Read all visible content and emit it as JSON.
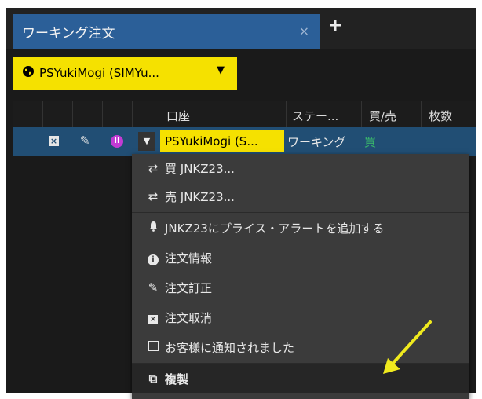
{
  "tab": {
    "title": "ワーキング注文",
    "close_icon": "×",
    "add_icon": "+"
  },
  "account_selector": {
    "label": "PSYukiMogi (SIMYu...",
    "globe_icon": "globe-icon",
    "caret": "▼"
  },
  "table": {
    "headers": [
      "口座",
      "ステー...",
      "買/売",
      "枚数"
    ],
    "row": {
      "cancel_icon": "×",
      "edit_icon": "✎",
      "pause_icon": "II",
      "dropdown": "▼",
      "account": "PSYukiMogi (S...",
      "status": "ワーキング",
      "side": "買"
    }
  },
  "context_menu": {
    "items": [
      {
        "icon": "⇄",
        "label": "買 JNKZ23..."
      },
      {
        "icon": "⇄",
        "label": "売 JNKZ23..."
      },
      {
        "icon": "🔔",
        "label": "JNKZ23にプライス・アラートを追加する"
      },
      {
        "icon": "i",
        "label": "注文情報"
      },
      {
        "icon": "✎",
        "label": "注文訂正"
      },
      {
        "icon": "×",
        "label": "注文取消"
      },
      {
        "icon": "□",
        "label": "お客様に通知されました"
      },
      {
        "icon": "⧉",
        "label": "複製"
      }
    ]
  },
  "colors": {
    "tab_active": "#2b5f98",
    "highlight_yellow": "#f5e100",
    "row_selected": "#214e74",
    "buy_green": "#3cc36a",
    "pause_magenta": "#c33bd4",
    "annotation_arrow": "#f0ea1e"
  }
}
